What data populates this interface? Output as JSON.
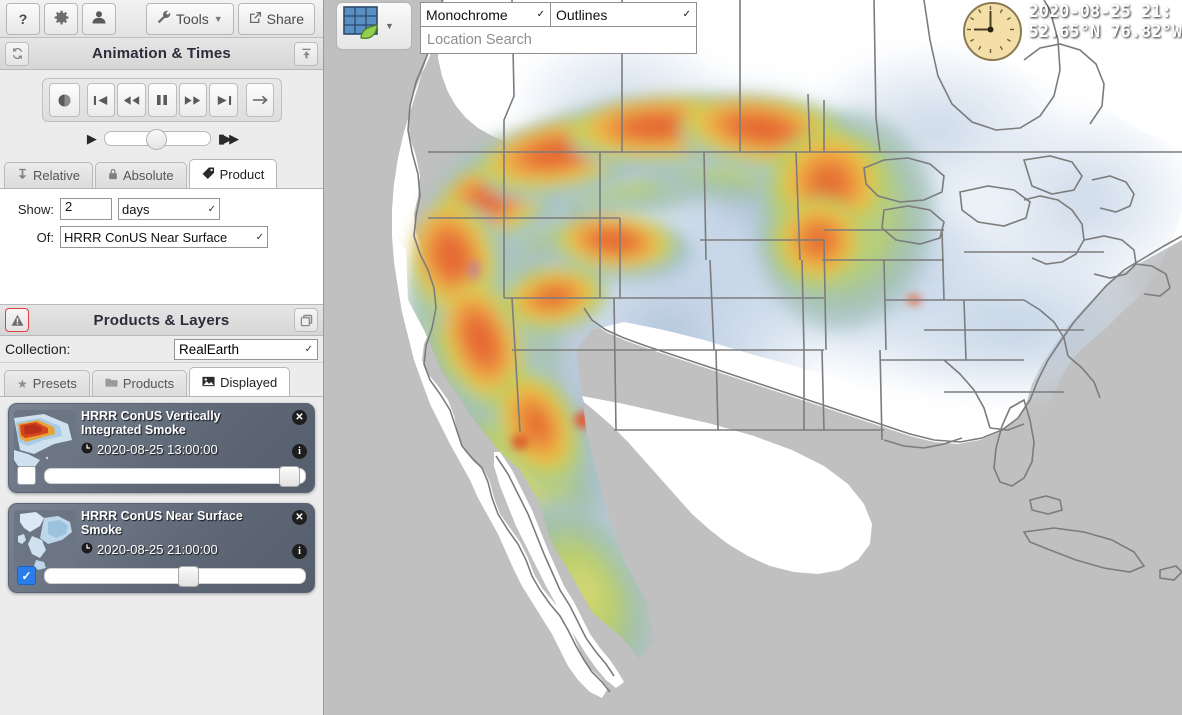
{
  "toolbar": {
    "help_label": "?",
    "settings_icon": "gear-icon",
    "account_icon": "user-icon",
    "tools_label": "Tools",
    "share_label": "Share"
  },
  "animation_panel": {
    "title": "Animation & Times",
    "refresh_icon": "refresh-icon",
    "collapse_icon": "collapse-up-icon",
    "controls": [
      {
        "name": "clock",
        "glyph": "◔"
      },
      {
        "name": "first",
        "glyph": "◀▌"
      },
      {
        "name": "rewind",
        "glyph": "◀◀"
      },
      {
        "name": "pause",
        "glyph": "▐▌"
      },
      {
        "name": "forward",
        "glyph": "▶▶"
      },
      {
        "name": "last",
        "glyph": "▌▶"
      },
      {
        "name": "step",
        "glyph": "→"
      }
    ],
    "speed_slider": {
      "play_glyph": "▶",
      "fast_glyph": "▶▶",
      "value_pct": 48
    },
    "tabs": [
      {
        "label": "Relative",
        "icon": "pin-icon",
        "active": false
      },
      {
        "label": "Absolute",
        "icon": "lock-icon",
        "active": false
      },
      {
        "label": "Product",
        "icon": "tag-icon",
        "active": true
      }
    ],
    "show_label": "Show:",
    "show_value": "2",
    "show_unit": "days",
    "of_label": "Of:",
    "of_value": "HRRR ConUS Near Surface"
  },
  "products_panel": {
    "title": "Products & Layers",
    "alert_icon": "warning-icon",
    "copy_icon": "copy-icon",
    "collection_label": "Collection:",
    "collection_value": "RealEarth",
    "tabs": [
      {
        "label": "Presets",
        "icon": "star-icon",
        "active": false
      },
      {
        "label": "Products",
        "icon": "folder-icon",
        "active": false
      },
      {
        "label": "Displayed",
        "icon": "image-icon",
        "active": true
      }
    ],
    "layers": [
      {
        "name": "HRRR ConUS Vertically Integrated Smoke",
        "time": "2020-08-25 13:00:00",
        "checked": false,
        "opacity_pct": 96,
        "thumb": "smoke-plume-red"
      },
      {
        "name": "HRRR ConUS Near Surface Smoke",
        "time": "2020-08-25 21:00:00",
        "checked": true,
        "opacity_pct": 55,
        "thumb": "smoke-plume-blue"
      }
    ]
  },
  "map": {
    "basemap_icon": "map-tiles-leaf-icon",
    "style_value": "Monochrome",
    "overlay_value": "Outlines",
    "search_placeholder": "Location Search",
    "timestamp": "2020-08-25 21:",
    "coordinates": "52.65°N  76.82°W",
    "clock_icon": "analog-clock-icon",
    "colors": {
      "ocean": "#c0c0c0",
      "land": "#ffffff",
      "border": "#808080",
      "smoke_low": "#b9cbe2",
      "smoke_mid": "#9dc94f",
      "smoke_high": "#f2c33a",
      "smoke_max": "#e0622e"
    }
  }
}
